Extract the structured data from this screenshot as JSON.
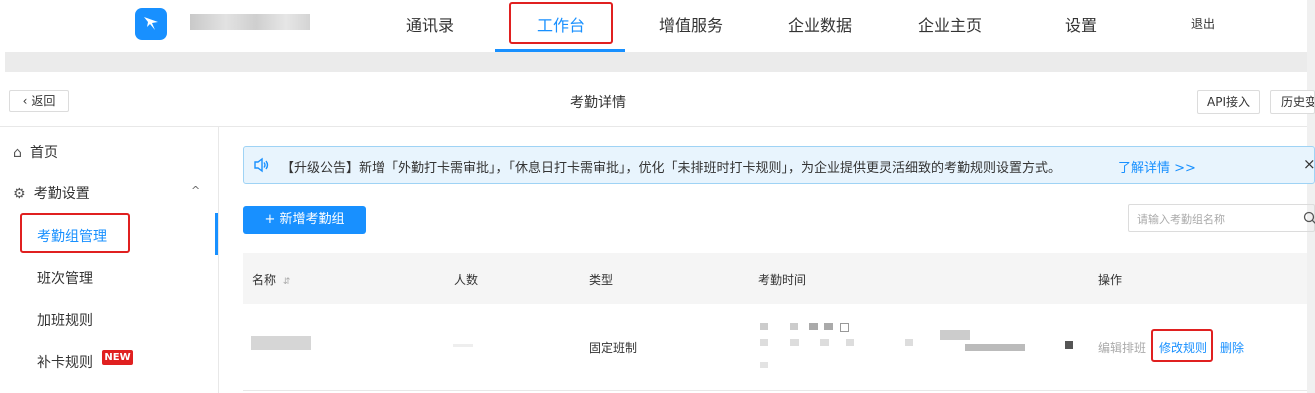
{
  "nav": {
    "items": [
      "通讯录",
      "工作台",
      "增值服务",
      "企业数据",
      "企业主页",
      "设置"
    ],
    "active": "工作台",
    "logout": "退出"
  },
  "subheader": {
    "back": "返回",
    "title": "考勤详情",
    "api": "API接入",
    "history": "历史变"
  },
  "sidebar": {
    "home": "首页",
    "attendance_settings": "考勤设置",
    "items": [
      "考勤组管理",
      "班次管理",
      "加班规则",
      "补卡规则"
    ],
    "active": "考勤组管理",
    "new_badge": "NEW"
  },
  "notice": {
    "text": "【升级公告】新增「外勤打卡需审批」，「休息日打卡需审批」，优化「未排班时打卡规则」，为企业提供更灵活细致的考勤规则设置方式。",
    "link": "了解详情 >>",
    "close": "×"
  },
  "toolbar": {
    "add": "+  新增考勤组",
    "search_placeholder": "请输入考勤组名称"
  },
  "table": {
    "headers": [
      "名称",
      "人数",
      "类型",
      "考勤时间",
      "操作"
    ],
    "rows": [
      {
        "type": "固定班制",
        "actions": [
          "编辑排班",
          "修改规则",
          "删除"
        ]
      }
    ]
  },
  "colors": {
    "accent": "#1890ff",
    "highlight": "#e02020"
  }
}
